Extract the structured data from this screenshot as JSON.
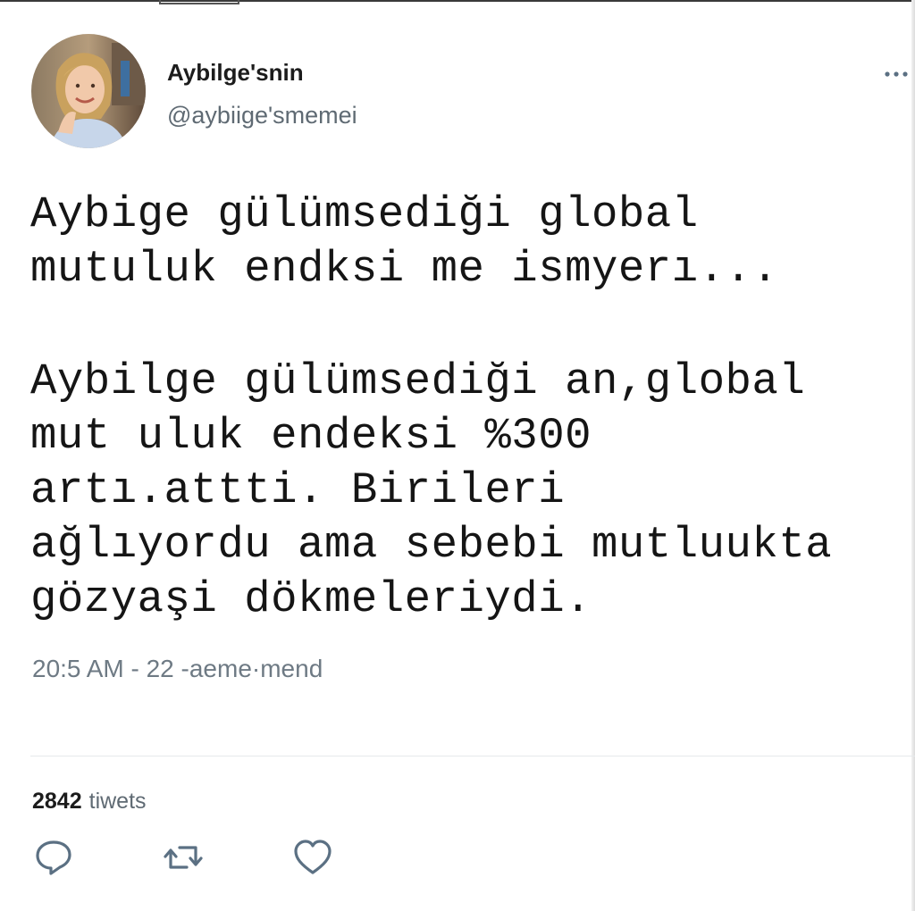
{
  "tweet": {
    "display_name": "Aybilge'snin",
    "handle": "@aybiige'smemei",
    "text_paragraph_1": [
      "Aybige gülümsediği global",
      "mutuluk endksi me ismyerı..."
    ],
    "text_paragraph_2": [
      "Aybilge gülümsediği an,global",
      "mut uluk endeksi %300",
      "artı.attti. Birileri",
      "ağlıyordu ama sebebi mutluukta",
      "gözyaşi dökmeleriydi."
    ],
    "timestamp": "20:5 AM - 22 -aeme·mend",
    "stats": {
      "count": "2842",
      "label": "tiwets"
    }
  },
  "icons": {
    "more": "more-horizontal-icon",
    "reply": "reply-icon",
    "retweet": "retweet-icon",
    "like": "heart-icon"
  },
  "colors": {
    "text": "#14171a",
    "secondary_text": "#5f6a73",
    "icon": "#5b7083",
    "divider": "#e6e9eb"
  }
}
